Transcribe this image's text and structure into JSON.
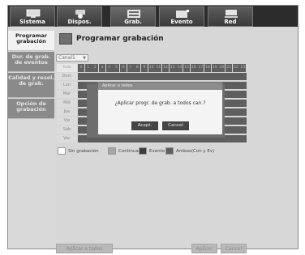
{
  "tabs": [
    {
      "label": "Sistema",
      "icon": "monitor-icon"
    },
    {
      "label": "Dispos.",
      "icon": "camera-icon"
    },
    {
      "label": "Grab.",
      "icon": "recorder-icon"
    },
    {
      "label": "Evento",
      "icon": "event-icon"
    },
    {
      "label": "Red",
      "icon": "network-icon"
    }
  ],
  "sidebar": {
    "items": [
      {
        "label": "Programar grabación"
      },
      {
        "label": "Dur. de grab. de eventos"
      },
      {
        "label": "Calidad y resol. de grab."
      },
      {
        "label": "Opción de grabación"
      }
    ]
  },
  "page": {
    "title": "Programar grabación",
    "channel": "Canal1",
    "todo_label": "Todo",
    "hours": [
      "0",
      "1",
      "2",
      "3",
      "4",
      "5",
      "6",
      "7",
      "8",
      "9",
      "10",
      "11",
      "12",
      "13",
      "14",
      "15",
      "16",
      "17",
      "18",
      "19",
      "20",
      "21",
      "22",
      "23"
    ],
    "days": [
      "Dom",
      "Lun",
      "Mar",
      "Mié",
      "Jue",
      "Vie",
      "Sáb",
      "Vac"
    ]
  },
  "legend": [
    {
      "label": "Sin grabación",
      "color": "#ffffff"
    },
    {
      "label": "Continua",
      "color": "#a6a6a6"
    },
    {
      "label": "Evento",
      "color": "#3c3c3c"
    },
    {
      "label": "Ambos(Con y Ev)",
      "color": "#5e5e5e"
    }
  ],
  "buttons": {
    "apply_all": "Aplicar a todos",
    "apply": "Aplicar",
    "cancel": "Cancel"
  },
  "dialog": {
    "title": "Aplicar a todos",
    "message": "¿Aplicar progr. de grab. a todos can.?",
    "ok": "Acept.",
    "cancel": "Cancel"
  }
}
